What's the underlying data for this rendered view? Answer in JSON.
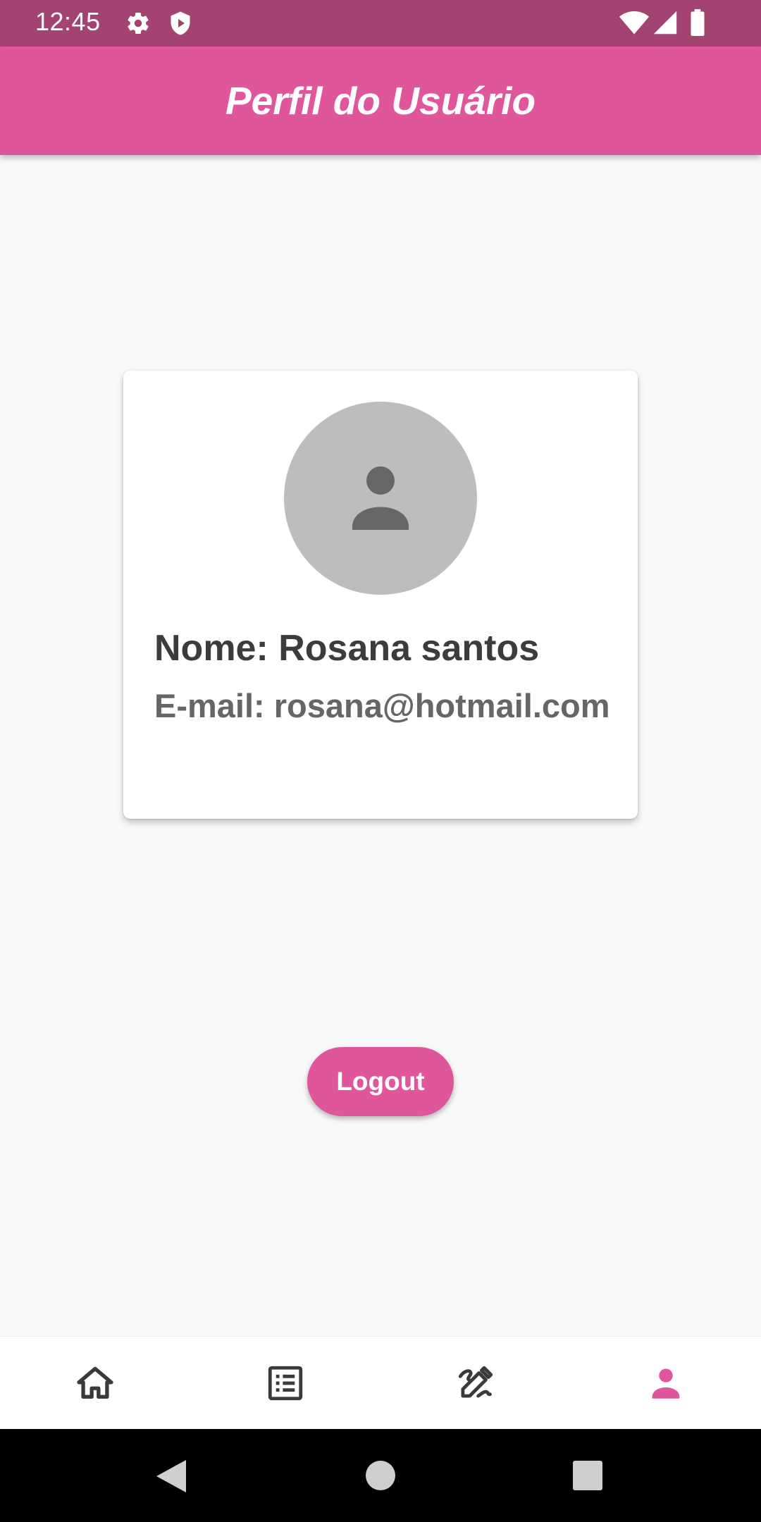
{
  "status_bar": {
    "time": "12:45",
    "icons_left": [
      "gear-icon",
      "shield-play-icon"
    ],
    "icons_right": [
      "wifi-icon",
      "cell-signal-icon",
      "battery-icon"
    ]
  },
  "app_bar": {
    "title": "Perfil do Usuário",
    "color": "#e0569a"
  },
  "profile": {
    "avatar_icon": "person-icon",
    "name": "Nome: Rosana santos",
    "email": "E-mail: rosana@hotmail.com"
  },
  "actions": {
    "logout_label": "Logout"
  },
  "bottom_nav": {
    "items": [
      {
        "icon": "home-icon",
        "active": false
      },
      {
        "icon": "list-icon",
        "active": false
      },
      {
        "icon": "edit-icon",
        "active": false
      },
      {
        "icon": "person-icon",
        "active": true
      }
    ],
    "active_color": "#e0569a",
    "inactive_color": "#3a3a3a"
  },
  "system_nav": {
    "icons": [
      "back-icon",
      "home-circle-icon",
      "recents-icon"
    ]
  }
}
